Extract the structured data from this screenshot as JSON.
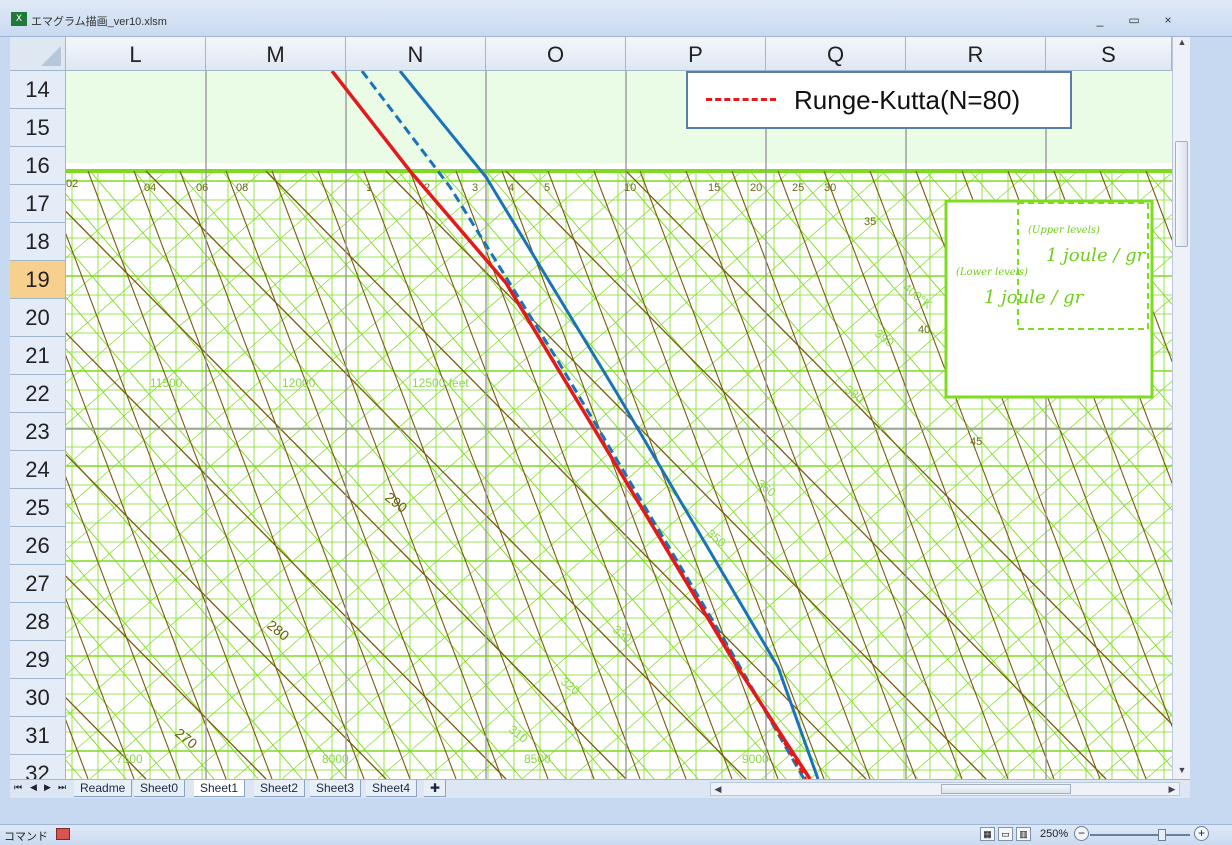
{
  "window": {
    "title": "エマグラム描画_ver10.xlsm",
    "icon": "excel-icon",
    "min_glyph": "_",
    "max_glyph": "▭",
    "close_glyph": "×"
  },
  "columns": [
    "L",
    "M",
    "N",
    "O",
    "P",
    "Q",
    "R",
    "S"
  ],
  "rows": [
    "14",
    "15",
    "16",
    "17",
    "18",
    "19",
    "20",
    "21",
    "22",
    "23",
    "24",
    "25",
    "26",
    "27",
    "28",
    "29",
    "30",
    "31",
    "32"
  ],
  "selected_row": "19",
  "legend": {
    "label": "Runge-Kutta(N=80)",
    "color": "#e3191c",
    "style": "dashed"
  },
  "chart_labels": {
    "bottom_ticks": [
      "02",
      "04",
      "06",
      "08",
      "1",
      "2",
      "3",
      "4",
      "5",
      "10",
      "15",
      "20",
      "25",
      "30"
    ],
    "isotherm_labels": [
      "290",
      "280",
      "270"
    ],
    "adiabat_labels": [
      "310",
      "320",
      "330",
      "350",
      "360",
      "380",
      "390",
      "400°K"
    ],
    "pressure_labels": [
      "11500",
      "12000",
      "12500 feet",
      "7500",
      "8000",
      "8500",
      "9000"
    ],
    "mixing_labels": [
      "35",
      "40",
      "45"
    ],
    "inset_upper": "(Upper levels)",
    "inset_upper_value": "1 joule / gr",
    "inset_lower": "(Lower levels)",
    "inset_lower_value": "1 joule / gr"
  },
  "lines": [
    {
      "name": "red-solid",
      "color": "#e3191c"
    },
    {
      "name": "blue-solid",
      "color": "#1a73b8"
    },
    {
      "name": "blue-dashed",
      "color": "#1a73b8"
    },
    {
      "name": "red-dashed",
      "color": "#e3191c"
    }
  ],
  "tabs": [
    "Readme",
    "Sheet0",
    "Sheet1",
    "Sheet2",
    "Sheet3",
    "Sheet4"
  ],
  "active_tab": "Sheet1",
  "nav": [
    "⏮",
    "◀",
    "▶",
    "⏭"
  ],
  "status": {
    "mode": "コマンド",
    "zoom": "250%"
  },
  "colors": {
    "grid_green": "#7ddc1f",
    "adiabat_brown": "#7a5a10",
    "chart_bg_light": "#eafbe6"
  }
}
